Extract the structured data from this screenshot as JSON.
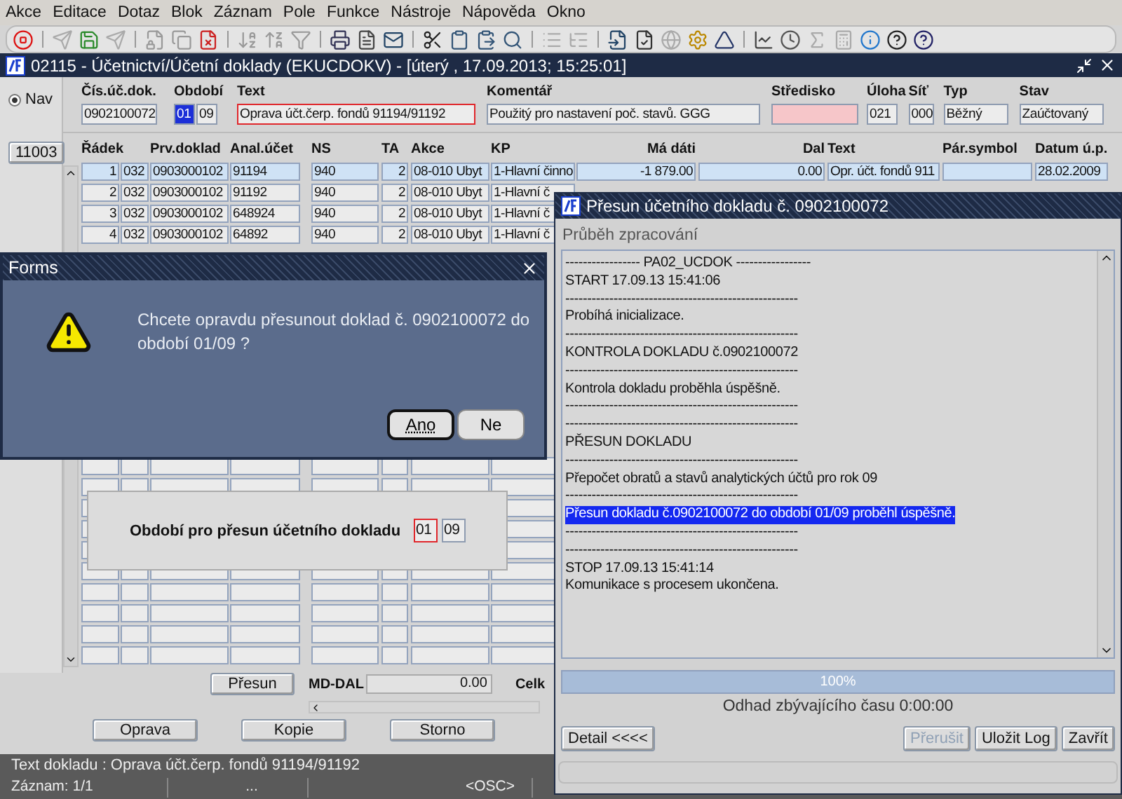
{
  "menu": [
    "Akce",
    "Editace",
    "Dotaz",
    "Blok",
    "Záznam",
    "Pole",
    "Funkce",
    "Nástroje",
    "Nápověda",
    "Okno"
  ],
  "window": {
    "title": "02115 - Účetnictví/Účetní doklady (EKUCDOKV) - [úterý  , 17.09.2013; 15:25:01]"
  },
  "header": {
    "nav": {
      "label": "Nav",
      "selected": true
    },
    "fields": [
      {
        "label": "Čís.úč.dok.",
        "value": "0902100072"
      },
      {
        "label": "Období",
        "parts": [
          {
            "value": "01",
            "selected": true
          },
          {
            "value": "09",
            "selected": false
          }
        ]
      },
      {
        "label": "Text",
        "value": "Oprava účt.čerp. fondů 91194/91192",
        "focused": true
      },
      {
        "label": "Komentář",
        "value": "Použitý pro nastavení poč. stavů.  GGG"
      },
      {
        "label": "Středisko",
        "required": true
      },
      {
        "label": "Úloha",
        "value": "021"
      },
      {
        "label": "Síť",
        "value": "000"
      },
      {
        "label": "Typ",
        "value": "Běžný"
      },
      {
        "label": "Stav",
        "value": "Zaúčtovaný"
      }
    ]
  },
  "record_button": "11003",
  "table": {
    "columns": [
      "Řádek",
      null,
      "Prv.doklad",
      "Anal.účet",
      "NS",
      "TA",
      "Akce",
      "KP",
      "Má dáti",
      "Dal",
      "Text",
      "Pár.symbol",
      "Datum ú.p."
    ],
    "rows": [
      {
        "selected": true,
        "cells": [
          "1",
          "032",
          "0903000102",
          "91194",
          "940",
          "2",
          "08-010 Ubyt",
          "1-Hlavní činno",
          "-1 879.00",
          "0.00",
          "Opr. účt. fondů 911",
          null,
          "28.02.2009"
        ]
      },
      {
        "selected": false,
        "cells": [
          "2",
          "032",
          "0903000102",
          "91192",
          "940",
          "2",
          "08-010 Ubyt",
          "1-Hlavní č"
        ]
      },
      {
        "selected": false,
        "cells": [
          "3",
          "032",
          "0903000102",
          "648924",
          "940",
          "2",
          "08-010 Ubyt",
          "1-Hlavní č"
        ]
      },
      {
        "selected": false,
        "cells": [
          "4",
          "032",
          "0903000102",
          "64892",
          "940",
          "2",
          "08-010 Ubyt",
          "1-Hlavní č"
        ]
      }
    ]
  },
  "period_panel": {
    "label": "Období pro přesun účetního dokladu",
    "parts": [
      {
        "value": "01",
        "focused": true
      },
      {
        "value": "09",
        "focused": false
      }
    ]
  },
  "move_button": "Přesun",
  "md_dal": {
    "label": "MD-DAL",
    "value": "0.00"
  },
  "total_label": "Celk",
  "actions": [
    "Oprava",
    "Kopie",
    "Storno"
  ],
  "status_bar": {
    "message": "Text dokladu : Oprava účt.čerp. fondů 91194/91192",
    "record": "Záznam: 1/1",
    "cells": [
      "...",
      "<OSC>"
    ]
  },
  "alert": {
    "title": "Forms",
    "message": "Chcete opravdu přesunout doklad č. 0902100072 do období 01/09 ?",
    "buttons": [
      {
        "label": "Ano",
        "selected": true
      },
      {
        "label": "Ne",
        "selected": false
      }
    ]
  },
  "progress_dialog": {
    "title": "Přesun účetního dokladu č. 0902100072",
    "section": "Průběh zpracování",
    "log": [
      {
        "text": "----------------- PA02_UCDOK -----------------",
        "selected": false
      },
      {
        "text": "START 17.09.13 15:41:06",
        "selected": false
      },
      {
        "text": "-----------------------------------------------------",
        "selected": false
      },
      {
        "text": "Probíhá inicializace.",
        "selected": false
      },
      {
        "text": "-----------------------------------------------------",
        "selected": false
      },
      {
        "text": "KONTROLA DOKLADU č.0902100072",
        "selected": false
      },
      {
        "text": "-----------------------------------------------------",
        "selected": false
      },
      {
        "text": "Kontrola dokladu proběhla úspěšně.",
        "selected": false
      },
      {
        "text": "-----------------------------------------------------",
        "selected": false
      },
      {
        "text": "-----------------------------------------------------",
        "selected": false
      },
      {
        "text": "PŘESUN DOKLADU",
        "selected": false
      },
      {
        "text": "-----------------------------------------------------",
        "selected": false
      },
      {
        "text": "Přepočet obratů a stavů analytických účtů pro rok 09",
        "selected": false
      },
      {
        "text": "-----------------------------------------------------",
        "selected": false
      },
      {
        "text": "Přesun dokladu č.0902100072 do období 01/09 proběhl úspěšně.",
        "selected": true
      },
      {
        "text": "-----------------------------------------------------",
        "selected": false
      },
      {
        "text": "-----------------------------------------------------",
        "selected": false
      },
      {
        "text": "STOP 17.09.13 15:41:14",
        "selected": false
      },
      {
        "text": "Komunikace s procesem ukončena.",
        "selected": false
      }
    ],
    "progress": {
      "level": 1,
      "label": "100%"
    },
    "eta": "Odhad zbývajícího času 0:00:00",
    "buttons": [
      {
        "label": "Detail <<<<",
        "disabled": false
      },
      {
        "label": "Přerušit",
        "disabled": true
      },
      {
        "label": "Uložit Log",
        "disabled": false
      },
      {
        "label": "Zavřít",
        "disabled": false
      }
    ]
  }
}
